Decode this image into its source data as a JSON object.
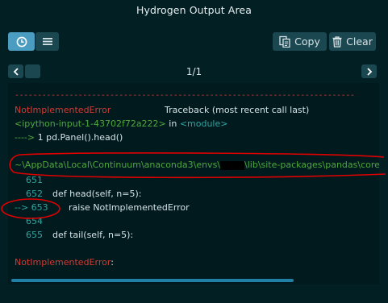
{
  "window": {
    "title": "Hydrogen Output Area"
  },
  "toolbar": {
    "history_icon": "clock-icon",
    "list_icon": "list-icon",
    "copy_label": "Copy",
    "copy_icon": "copy-icon",
    "clear_label": "Clear",
    "clear_icon": "trash-icon"
  },
  "pager": {
    "prev_icon": "chevron-left-icon",
    "next_icon": "chevron-right-icon",
    "counter": "1/1"
  },
  "traceback": {
    "dashes": "---------------------------------------------------------------------------",
    "error_name": "NotImplementedError",
    "traceback_header": "Traceback (most recent call last)",
    "input_ref": "<ipython-input-1-43702f72a222>",
    "input_in": " in ",
    "input_module": "<module>",
    "input_arrow": "---->",
    "input_line": " 1 pd.Panel().head()",
    "path_prefix": "~\\AppData\\Local\\Continuum\\anaconda3\\envs\\",
    "path_suffix": "\\lib\\site-packages\\pandas\\core\\",
    "lines": [
      {
        "num": "651",
        "code": ""
      },
      {
        "num": "652",
        "code": "def head(self, n=5):"
      },
      {
        "num": "653",
        "arrow": "-->",
        "code": "raise NotImplementedError"
      },
      {
        "num": "654",
        "code": ""
      },
      {
        "num": "655",
        "code": "def tail(self, n=5):"
      }
    ],
    "final_error": "NotImplementedError",
    "final_colon": ":"
  },
  "colors": {
    "background": "#021f24",
    "error_red": "#d43a33",
    "path_green": "#4ea83c",
    "line_teal": "#2fa6a1",
    "accent_blue": "#4a9cc0",
    "annotation_red": "#e00000"
  }
}
